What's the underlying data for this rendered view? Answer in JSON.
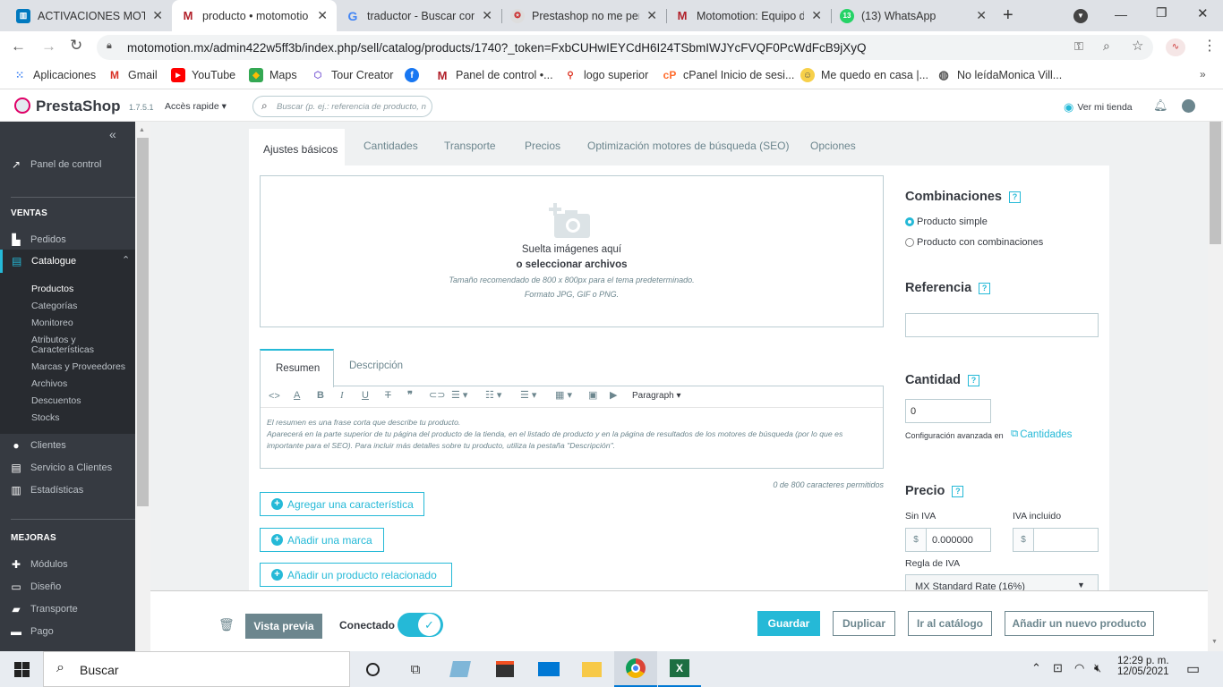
{
  "browser": {
    "tabs": [
      {
        "title": "ACTIVACIONES MOTO",
        "icon": "trello-icon",
        "active": false
      },
      {
        "title": "producto • motomotio",
        "icon": "motomotion-icon",
        "active": true
      },
      {
        "title": "traductor - Buscar con",
        "icon": "google-icon",
        "active": false
      },
      {
        "title": "Prestashop no me per",
        "icon": "prestashop-icon",
        "active": false
      },
      {
        "title": "Motomotion: Equipo d",
        "icon": "motomotion-icon",
        "active": false
      },
      {
        "title": "(13) WhatsApp",
        "icon": "whatsapp-icon",
        "active": false
      }
    ],
    "whatsapp_badge": "13",
    "url": "motomotion.mx/admin422w5ff3b/index.php/sell/catalog/products/1740?_token=FxbCUHwIEYCdH6I24TSbmIWJYcFVQF0PcWdFcB9jXyQ",
    "bookmarks": [
      {
        "label": "Aplicaciones",
        "icon": "apps-icon"
      },
      {
        "label": "Gmail",
        "icon": "gmail-icon"
      },
      {
        "label": "YouTube",
        "icon": "youtube-icon"
      },
      {
        "label": "Maps",
        "icon": "maps-icon"
      },
      {
        "label": "Tour Creator",
        "icon": "tour-creator-icon"
      },
      {
        "label": "",
        "icon": "facebook-icon"
      },
      {
        "label": "Panel de control •...",
        "icon": "motomotion-icon"
      },
      {
        "label": "logo superior",
        "icon": "clip-icon"
      },
      {
        "label": "cPanel Inicio de sesi...",
        "icon": "cpanel-icon"
      },
      {
        "label": "Me quedo en casa |...",
        "icon": "mequedo-icon"
      },
      {
        "label": "No leídaMonica Vill...",
        "icon": "globe-icon"
      }
    ]
  },
  "ps_header": {
    "brand": "PrestaShop",
    "version": "1.7.5.1",
    "quick_access": "Accès rapide",
    "search_placeholder": "Buscar (p. ej.: referencia de producto, n",
    "view_store": "Ver mi tienda"
  },
  "sidebar": {
    "collapse": "«",
    "dashboard": "Panel de control",
    "sections": {
      "ventas": "VENTAS",
      "mejoras": "MEJORAS"
    },
    "ventas_items": [
      {
        "label": "Pedidos",
        "icon": "shop-icon"
      },
      {
        "label": "Catalogue",
        "icon": "catalog-icon"
      }
    ],
    "catalog_sub": [
      "Productos",
      "Categorías",
      "Monitoreo",
      "Atributos y Características",
      "Marcas y Proveedores",
      "Archivos",
      "Descuentos",
      "Stocks"
    ],
    "other_items": [
      {
        "label": "Clientes",
        "icon": "user-icon"
      },
      {
        "label": "Servicio a Clientes",
        "icon": "chat-icon"
      },
      {
        "label": "Estadísticas",
        "icon": "stats-icon"
      }
    ],
    "mejoras_items": [
      {
        "label": "Módulos",
        "icon": "puzzle-icon"
      },
      {
        "label": "Diseño",
        "icon": "monitor-icon"
      },
      {
        "label": "Transporte",
        "icon": "truck-icon"
      },
      {
        "label": "Pago",
        "icon": "card-icon"
      }
    ]
  },
  "product_tabs": [
    "Ajustes básicos",
    "Cantidades",
    "Transporte",
    "Precios",
    "Optimización motores de búsqueda (SEO)",
    "Opciones"
  ],
  "dropzone": {
    "line1": "Suelta imágenes aquí",
    "line2": "o seleccionar archivos",
    "hint1": "Tamaño recomendado de 800 x 800px para el tema predeterminado.",
    "hint2": "Formato JPG, GIF o PNG."
  },
  "editor": {
    "tabs": [
      "Resumen",
      "Descripción"
    ],
    "paragraph": "Paragraph",
    "placeholder1": "El resumen es una frase corta que describe tu producto.",
    "placeholder2": "Aparecerá en la parte superior de tu página del producto de la tienda, en el listado de producto y en la página de resultados de los motores de búsqueda (por lo que es importante para el SEO). Para incluir más detalles sobre tu producto, utiliza la pestaña \"Descripción\".",
    "counter": "0 de 800 caracteres permitidos"
  },
  "actions": [
    "Agregar una característica",
    "Añadir una marca",
    "Añadir un producto relacionado"
  ],
  "right": {
    "combinations_title": "Combinaciones",
    "option_simple": "Producto simple",
    "option_combos": "Producto con combinaciones",
    "reference_title": "Referencia",
    "reference_value": "",
    "quantity_title": "Cantidad",
    "quantity_value": "0",
    "advanced_config": "Configuración avanzada en",
    "quantities_link": "Cantidades",
    "price_title": "Precio",
    "tax_excl_label": "Sin IVA",
    "tax_incl_label": "IVA incluido",
    "currency": "$",
    "tax_excl_value": "0.000000",
    "tax_incl_value": "",
    "tax_rule_label": "Regla de IVA",
    "tax_rule_value": "MX Standard Rate (16%)"
  },
  "help_mark": "?",
  "footer": {
    "preview": "Vista previa",
    "online": "Conectado",
    "save": "Guardar",
    "duplicate": "Duplicar",
    "go_catalog": "Ir al catálogo",
    "add_new": "Añadir un nuevo producto"
  },
  "taskbar": {
    "search": "Buscar",
    "time": "12:29 p. m.",
    "date": "12/05/2021"
  },
  "colors": {
    "accent": "#25b9d7",
    "sidebar": "#363a41",
    "preview_btn": "#6c868e"
  }
}
